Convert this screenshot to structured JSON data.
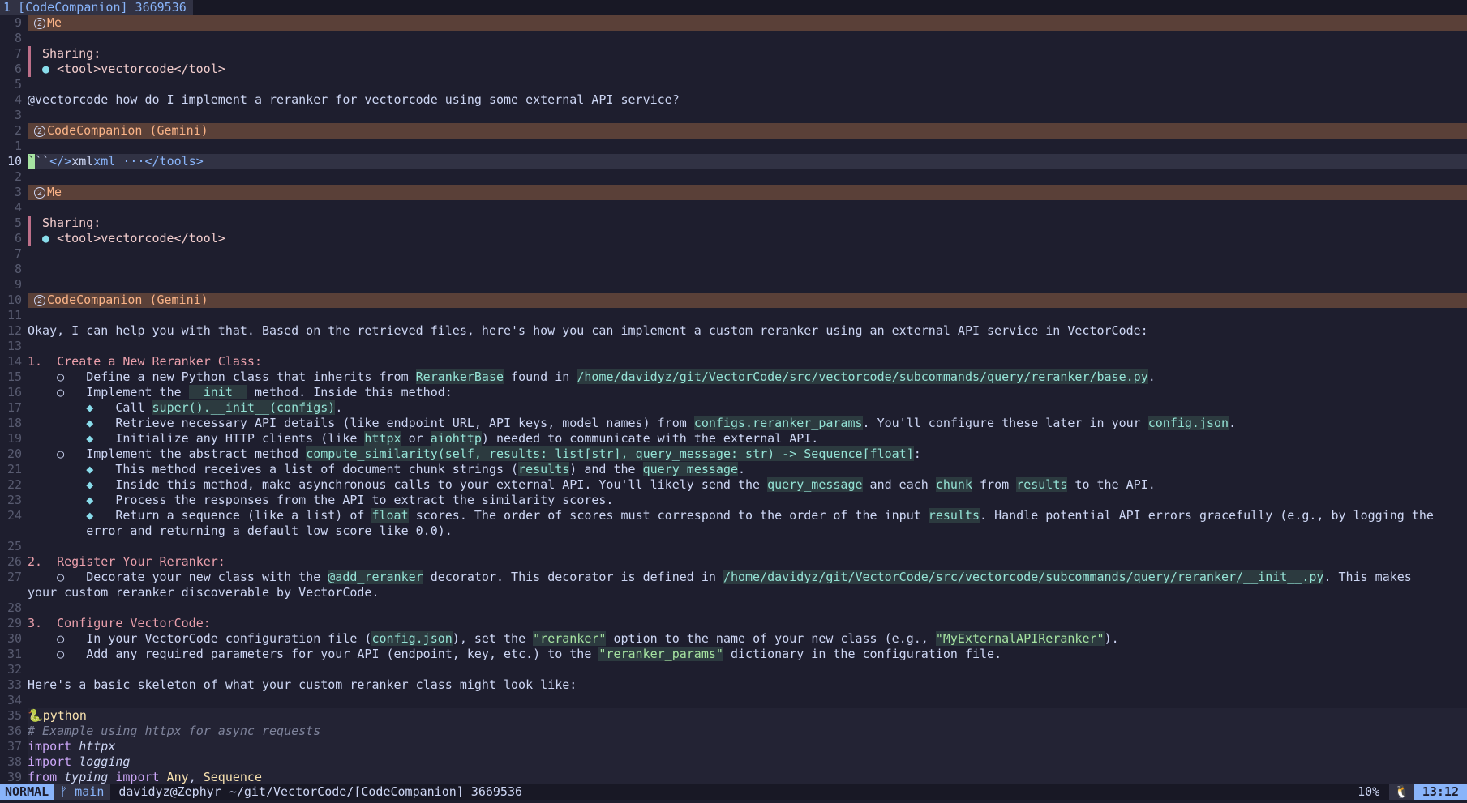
{
  "tabline": {
    "tab_label": "1 [CodeCompanion] 3669536"
  },
  "statusline": {
    "mode": "NORMAL",
    "branch_icon": "git-branch-icon",
    "branch": "main",
    "host": "davidyz@Zephyr",
    "path": "~/git/VectorCode/[CodeCompanion] 3669536",
    "percent": "10%",
    "os_icon": "linux-icon",
    "clock": "13:12"
  },
  "lines": {
    "l1": {
      "n": "9",
      "text": "Me"
    },
    "l2": {
      "n": "8"
    },
    "l3": {
      "n": "7",
      "text": "Sharing:"
    },
    "l4": {
      "n": "6",
      "text": "<tool>vectorcode</tool>"
    },
    "l5": {
      "n": "5"
    },
    "l6": {
      "n": "4",
      "text": "@vectorcode how do I implement a reranker for vectorcode using some external API service?"
    },
    "l7": {
      "n": "3"
    },
    "l8": {
      "n": "2",
      "text": "CodeCompanion (Gemini)"
    },
    "l9": {
      "n": "1"
    },
    "l10": {
      "n": "10",
      "a": "``",
      "b": "xml",
      "c": "xml ···</tools>"
    },
    "l11": {
      "n": "2"
    },
    "l12": {
      "n": "3",
      "text": "Me"
    },
    "l13": {
      "n": "4"
    },
    "l14": {
      "n": "5",
      "text": "Sharing:"
    },
    "l15": {
      "n": "6",
      "text": "<tool>vectorcode</tool>"
    },
    "l16": {
      "n": "7"
    },
    "l17": {
      "n": "8"
    },
    "l18": {
      "n": "9"
    },
    "l19": {
      "n": "10",
      "text": "CodeCompanion (Gemini)"
    },
    "l20": {
      "n": "11"
    },
    "l21": {
      "n": "12",
      "text": "Okay, I can help you with that. Based on the retrieved files, here's how you can implement a custom reranker using an external API service in VectorCode:"
    },
    "l22": {
      "n": "13"
    },
    "l23": {
      "n": "14",
      "num": "1.",
      "text": "Create a New Reranker Class:"
    },
    "l24": {
      "n": "15",
      "a": "Define a new Python class that inherits from ",
      "b": "RerankerBase",
      "c": " found in ",
      "d": "/home/davidyz/git/VectorCode/src/vectorcode/subcommands/query/reranker/base.py",
      "e": "."
    },
    "l25": {
      "n": "16",
      "a": "Implement the ",
      "b": "__init__",
      "c": " method. Inside this method:"
    },
    "l26": {
      "n": "17",
      "a": "Call ",
      "b": "super().__init__(configs)",
      "c": "."
    },
    "l27": {
      "n": "18",
      "a": "Retrieve necessary API details (like endpoint URL, API keys, model names) from ",
      "b": "configs.reranker_params",
      "c": ". You'll configure these later in your ",
      "d": "config.json",
      "e": "."
    },
    "l28": {
      "n": "19",
      "a": "Initialize any HTTP clients (like ",
      "b": "httpx",
      "c": " or ",
      "d": "aiohttp",
      "e": ") needed to communicate with the external API."
    },
    "l29": {
      "n": "20",
      "a": "Implement the abstract method ",
      "b": "compute_similarity(self, results: list[str], query_message: str) -> Sequence[float]",
      "c": ":"
    },
    "l30": {
      "n": "21",
      "a": "This method receives a list of document chunk strings (",
      "b": "results",
      "c": ") and the ",
      "d": "query_message",
      "e": "."
    },
    "l31": {
      "n": "22",
      "a": "Inside this method, make asynchronous calls to your external API. You'll likely send the ",
      "b": "query_message",
      "c": " and each ",
      "d": "chunk",
      "e": " from ",
      "f": "results",
      "g": " to the API."
    },
    "l32": {
      "n": "23",
      "a": "Process the responses from the API to extract the similarity scores."
    },
    "l33": {
      "n": "24",
      "a": "Return a sequence (like a list) of ",
      "b": "float",
      "c": " scores. The order of scores must correspond to the order of the input ",
      "d": "results",
      "e": ". Handle potential API errors gracefully (e.g., by logging the"
    },
    "l34": {
      "n": "",
      "a": "error and returning a default low score like 0.0)."
    },
    "l35": {
      "n": "25"
    },
    "l36": {
      "n": "26",
      "num": "2.",
      "text": "Register Your Reranker:"
    },
    "l37": {
      "n": "27",
      "a": "Decorate your new class with the ",
      "b": "@add_reranker",
      "c": " decorator. This decorator is defined in ",
      "d": "/home/davidyz/git/VectorCode/src/vectorcode/subcommands/query/reranker/__init__.py",
      "e": ". This makes"
    },
    "l38": {
      "n": "",
      "a": "your custom reranker discoverable by VectorCode."
    },
    "l39": {
      "n": "28"
    },
    "l40": {
      "n": "29",
      "num": "3.",
      "text": "Configure VectorCode:"
    },
    "l41": {
      "n": "30",
      "a": "In your VectorCode configuration file (",
      "b": "config.json",
      "c": "), set the ",
      "d": "\"reranker\"",
      "e": " option to the name of your new class (e.g., ",
      "f": "\"MyExternalAPIReranker\"",
      "g": ")."
    },
    "l42": {
      "n": "31",
      "a": "Add any required parameters for your API (endpoint, key, etc.) to the ",
      "b": "\"reranker_params\"",
      "c": " dictionary in the configuration file."
    },
    "l43": {
      "n": "32"
    },
    "l44": {
      "n": "33",
      "text": "Here's a basic skeleton of what your custom reranker class might look like:"
    },
    "l45": {
      "n": "34"
    },
    "l46": {
      "n": "35",
      "text": "python"
    },
    "l47": {
      "n": "36",
      "text": "# Example using httpx for async requests"
    },
    "l48": {
      "n": "37",
      "kw": "import",
      "mod": "httpx"
    },
    "l49": {
      "n": "38",
      "kw": "import",
      "mod": "logging"
    },
    "l50": {
      "n": "39",
      "kw": "from",
      "mod": "typing",
      "kw2": "import",
      "t1": "Any",
      "sep": ", ",
      "t2": "Sequence"
    }
  }
}
